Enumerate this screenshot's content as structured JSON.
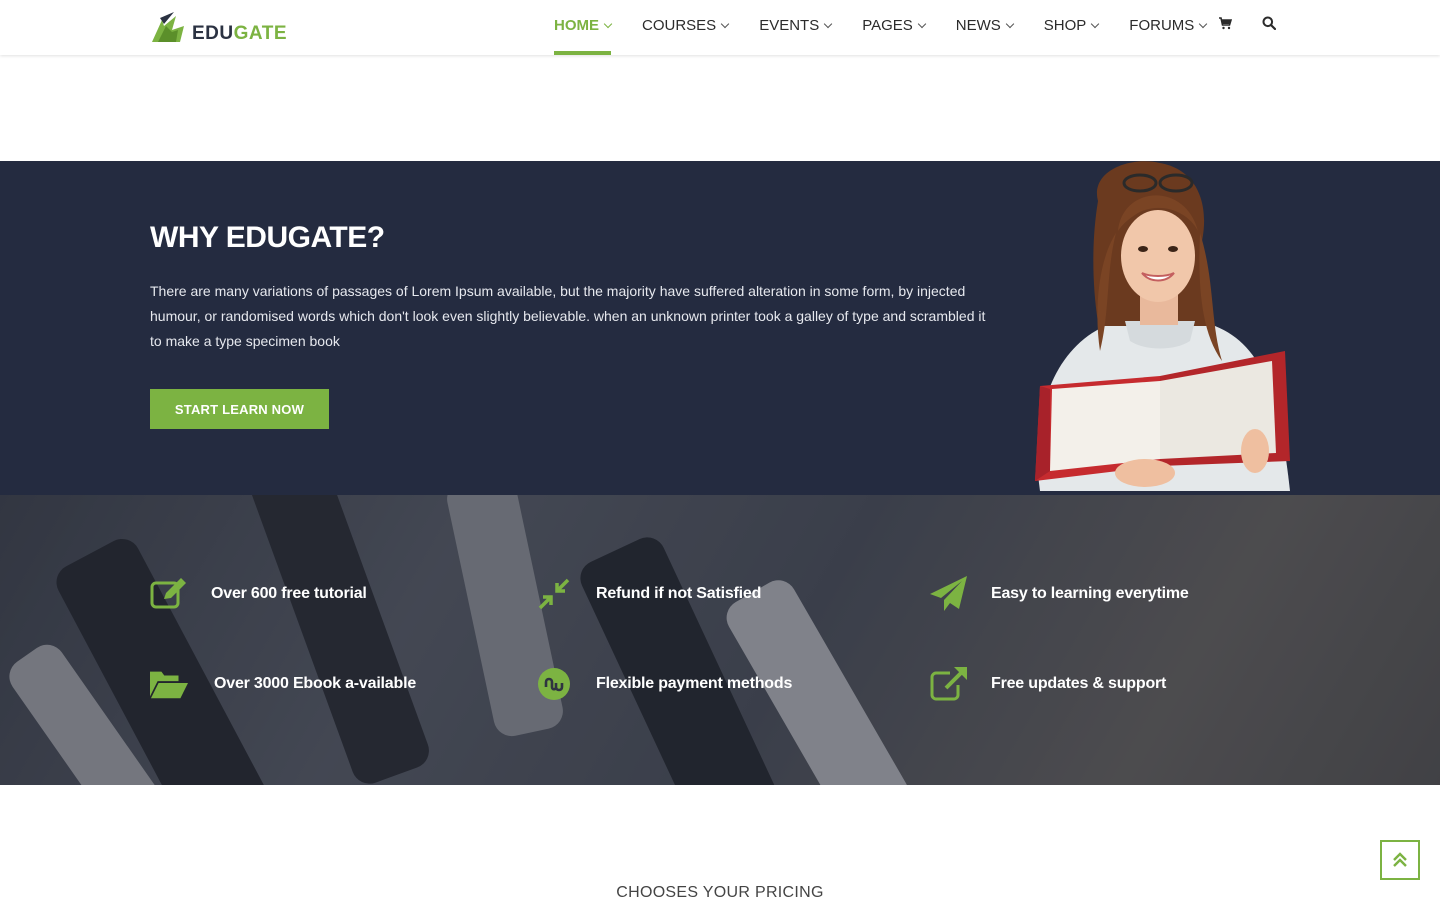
{
  "brand": {
    "logo_part1": "EDU",
    "logo_part2": "GATE",
    "accent": "#7cb342",
    "dark": "#242b40"
  },
  "nav": {
    "items": [
      {
        "label": "HOME",
        "active": true
      },
      {
        "label": "COURSES"
      },
      {
        "label": "EVENTS"
      },
      {
        "label": "PAGES"
      },
      {
        "label": "NEWS"
      },
      {
        "label": "SHOP"
      },
      {
        "label": "FORUMS"
      }
    ],
    "cart_icon": "cart-icon",
    "search_icon": "search-icon"
  },
  "why": {
    "title": "WHY EDUGATE?",
    "text": "There are many variations of passages of Lorem Ipsum available, but the majority have suffered alteration in some form, by injected humour, or randomised words which don't look even slightly believable. when an unknown printer took a galley of type and scrambled it to make a type specimen book",
    "button": "START LEARN NOW"
  },
  "features": [
    {
      "label": "Over 600 free tutorial",
      "icon": "edit-icon"
    },
    {
      "label": "Refund if not Satisfied",
      "icon": "compress-icon"
    },
    {
      "label": "Easy to learning everytime",
      "icon": "paper-plane-icon"
    },
    {
      "label": "Over 3000 Ebook a-vailable",
      "icon": "folder-open-icon"
    },
    {
      "label": "Flexible payment methods",
      "icon": "stumbleupon-icon"
    },
    {
      "label": "Free updates & support",
      "icon": "external-link-icon"
    }
  ],
  "pricing": {
    "title": "CHOOSES YOUR PRICING"
  },
  "scroll_top": {
    "icon": "double-chevron-up-icon"
  }
}
